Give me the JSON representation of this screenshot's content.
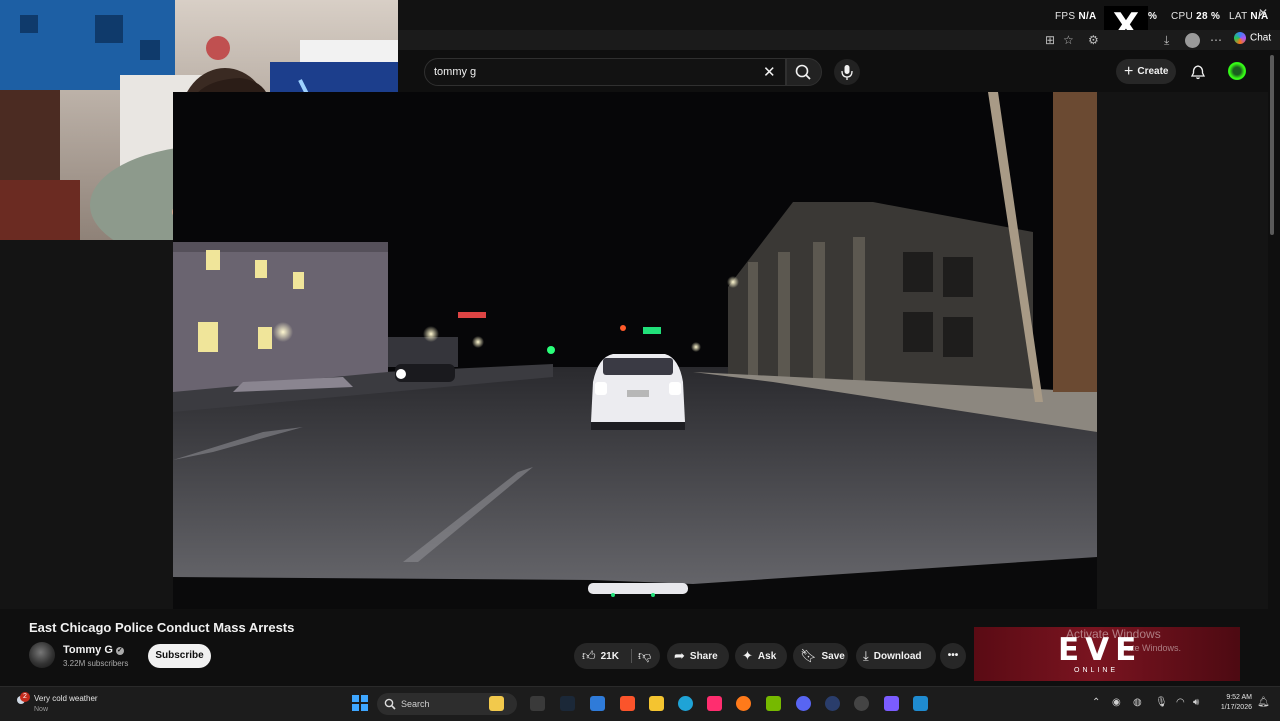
{
  "hud": {
    "fps_label": "FPS",
    "fps_value": "N/A",
    "pct_partial": "%",
    "cpu_label": "CPU",
    "cpu_value": "28",
    "cpu_unit": "%",
    "lat_label": "LAT",
    "lat_value": "N/A",
    "x_logo": "X"
  },
  "browser": {
    "chat_label": "Chat"
  },
  "youtube": {
    "search_value": "tommy g",
    "create_label": "Create"
  },
  "video": {
    "title": "East Chicago Police Conduct Mass Arrests",
    "channel_name": "Tommy G",
    "subscribers": "3.22M subscribers",
    "subscribe_label": "Subscribe",
    "likes": "21K",
    "share_label": "Share",
    "ask_label": "Ask",
    "save_label": "Save",
    "download_label": "Download",
    "more_label": "•••"
  },
  "ad": {
    "logo_text": "EVE",
    "logo_sub": "ONLINE"
  },
  "watermark": {
    "line1": "Activate Windows",
    "line2_partial": "ate Windows."
  },
  "taskbar": {
    "notification_count": "2",
    "weather_text": "Very cold weather",
    "weather_sub": "Now",
    "search_placeholder": "Search",
    "time": "9:52 AM",
    "date": "1/17/2026"
  },
  "colors": {
    "yt_bg": "#0f0f0f",
    "pill_bg": "#272727",
    "accent_blue": "#3ea6ff",
    "ad_red": "#7a1420"
  },
  "icons": {
    "search": "search-icon",
    "mic": "mic-icon",
    "bell": "bell-icon",
    "like": "thumbs-up-icon",
    "dislike": "thumbs-down-icon",
    "share": "share-arrow-icon",
    "ask": "sparkle-icon",
    "save": "bookmark-icon",
    "download": "download-icon"
  }
}
